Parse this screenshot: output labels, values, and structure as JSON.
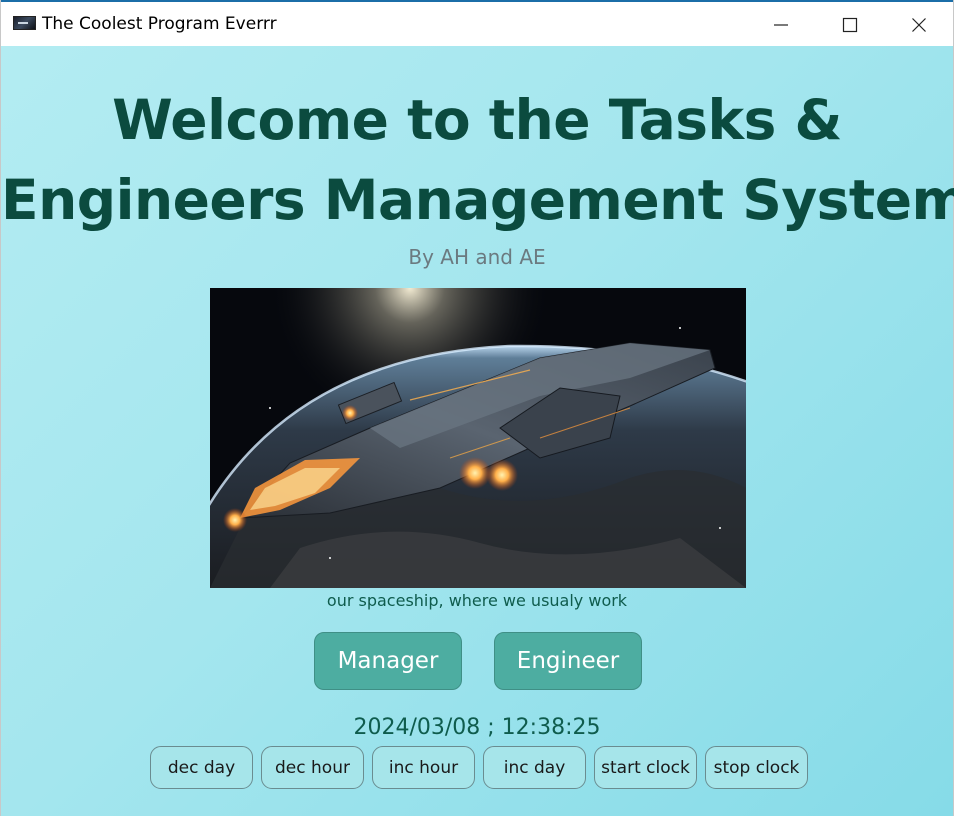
{
  "window": {
    "title": "The Coolest Program Everrr",
    "app_icon": "spaceship-thumbnail-icon",
    "controls": {
      "minimize_icon": "minimize-icon",
      "maximize_icon": "maximize-icon",
      "close_icon": "close-icon"
    }
  },
  "main": {
    "heading_line1": "Welcome to the Tasks &",
    "heading_line2": "Engineers Management System",
    "byline": "By AH and AE",
    "image_caption": "our spaceship, where we usualy work"
  },
  "roles": {
    "manager_label": "Manager",
    "engineer_label": "Engineer"
  },
  "clock": {
    "display": "2024/03/08 ; 12:38:25",
    "buttons": [
      "dec day",
      "dec hour",
      "inc hour",
      "inc day",
      "start clock",
      "stop clock"
    ]
  },
  "colors": {
    "heading": "#0b4b3f",
    "background": "#a4e6ee",
    "role_button": "#4dada1",
    "control_button": "#a6e5ea",
    "titlebar_accent": "#1b6ea8"
  }
}
